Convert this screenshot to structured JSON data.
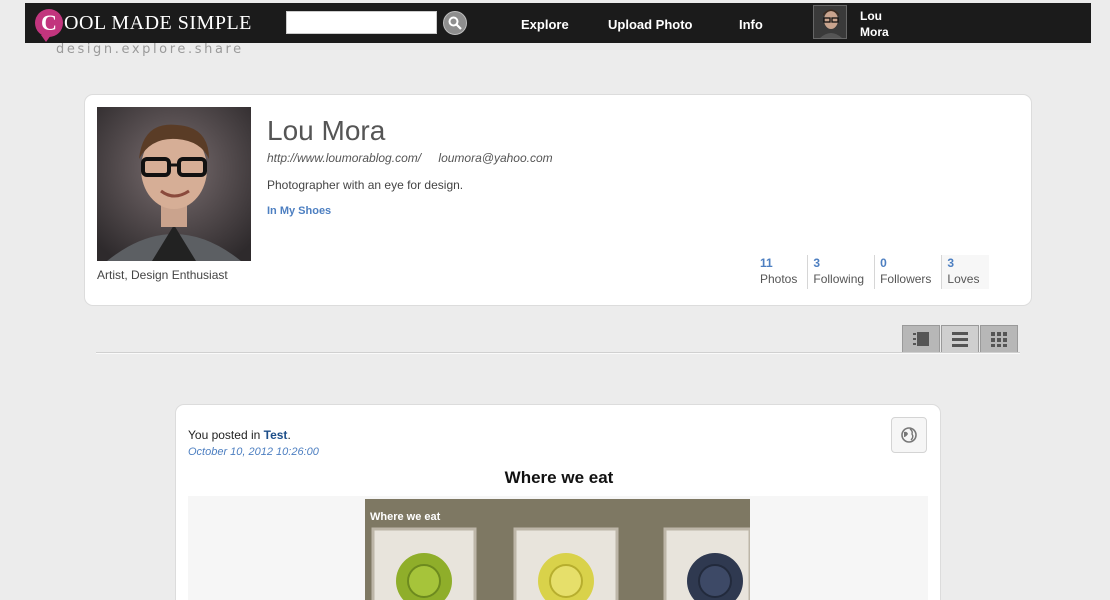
{
  "header": {
    "logo_letter": "C",
    "logo_text": "OOL MADE SIMPLE",
    "tagline": "design.explore.share",
    "search": {
      "placeholder": ""
    },
    "nav": [
      {
        "label": "Explore"
      },
      {
        "label": "Upload Photo"
      },
      {
        "label": "Info"
      }
    ],
    "user": {
      "first": "Lou",
      "last": "Mora"
    }
  },
  "profile": {
    "name": "Lou Mora",
    "website": "http://www.loumorablog.com/",
    "email": "loumora@yahoo.com",
    "bio": "Photographer with an eye for design.",
    "album_link": "In My Shoes",
    "role": "Artist, Design Enthusiast",
    "stats": [
      {
        "count": "11",
        "label": "Photos"
      },
      {
        "count": "3",
        "label": "Following"
      },
      {
        "count": "0",
        "label": "Followers"
      },
      {
        "count": "3",
        "label": "Loves"
      }
    ]
  },
  "view_modes": [
    "list-view",
    "detail-view",
    "grid-view"
  ],
  "post": {
    "meta_prefix": "You posted in",
    "category": "Test",
    "meta_suffix": ".",
    "date": "October 10, 2012 10:26:00",
    "title": "Where we eat",
    "image_caption": "Where we eat"
  },
  "colors": {
    "topbar": "#1b1b1b",
    "brand": "#c2357e",
    "link": "#4d7fc1",
    "background": "#ececec"
  }
}
